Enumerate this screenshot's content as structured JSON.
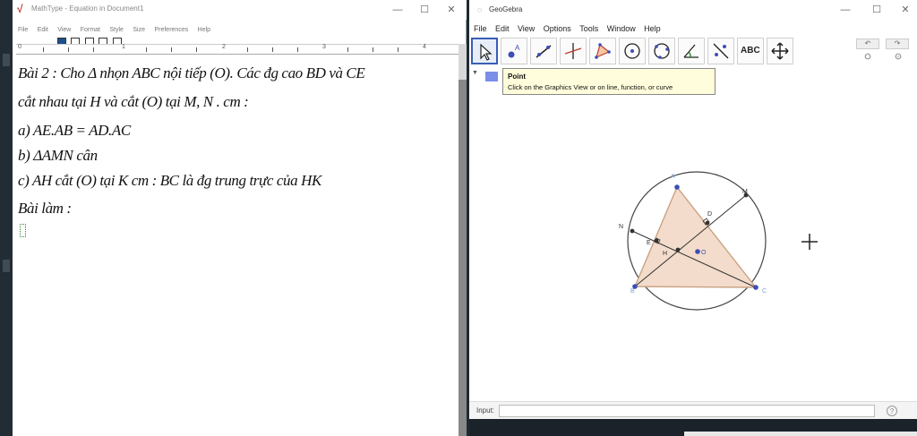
{
  "mathtype": {
    "title": "MathType - Equation in Document1",
    "menu": [
      "File",
      "Edit",
      "View",
      "Format",
      "Style",
      "Size",
      "Preferences",
      "Help"
    ],
    "window_controls": [
      "—",
      "☐",
      "✕"
    ],
    "ruler_numbers": [
      "0",
      "1",
      "2",
      "3",
      "4"
    ],
    "lines": [
      "Bài 2 : Cho Δ nhọn ABC nội tiếp (O). Các đg cao BD và CE",
      "cắt nhau tại H và cắt (O) tại M, N . cm :",
      "a) AE.AB = AD.AC",
      "b) ΔAMN cân",
      "c) AH cắt (O) tại K cm : BC là đg trung trực của HK",
      "Bài làm :"
    ]
  },
  "geogebra": {
    "title": "GeoGebra",
    "menu": [
      "File",
      "Edit",
      "View",
      "Options",
      "Tools",
      "Window",
      "Help"
    ],
    "window_controls": [
      "—",
      "☐",
      "✕"
    ],
    "toolbar": [
      "move-tool",
      "point-tool",
      "line-tool",
      "perpendicular-tool",
      "polygon-tool",
      "circle-tool",
      "circle-three-points-tool",
      "angle-tool",
      "reflect-tool",
      "text-tool",
      "move-graphics-tool"
    ],
    "text_tool_label": "ABC",
    "undo_label": "↶",
    "redo_label": "↷",
    "tooltip": {
      "title": "Point",
      "text": "Click on the Graphics View or on line, function, or curve"
    },
    "input_label": "Input:",
    "help_label": "?",
    "point_labels": {
      "A": "A",
      "B": "B",
      "C": "C",
      "D": "D",
      "E": "E",
      "H": "H",
      "O": "O",
      "M": "M",
      "N": "N"
    },
    "colors": {
      "triangle_fill": "#f3dccb",
      "triangle_edge": "#c9a283",
      "point_blue": "#3b4fb5",
      "point_dark": "#333333"
    }
  }
}
